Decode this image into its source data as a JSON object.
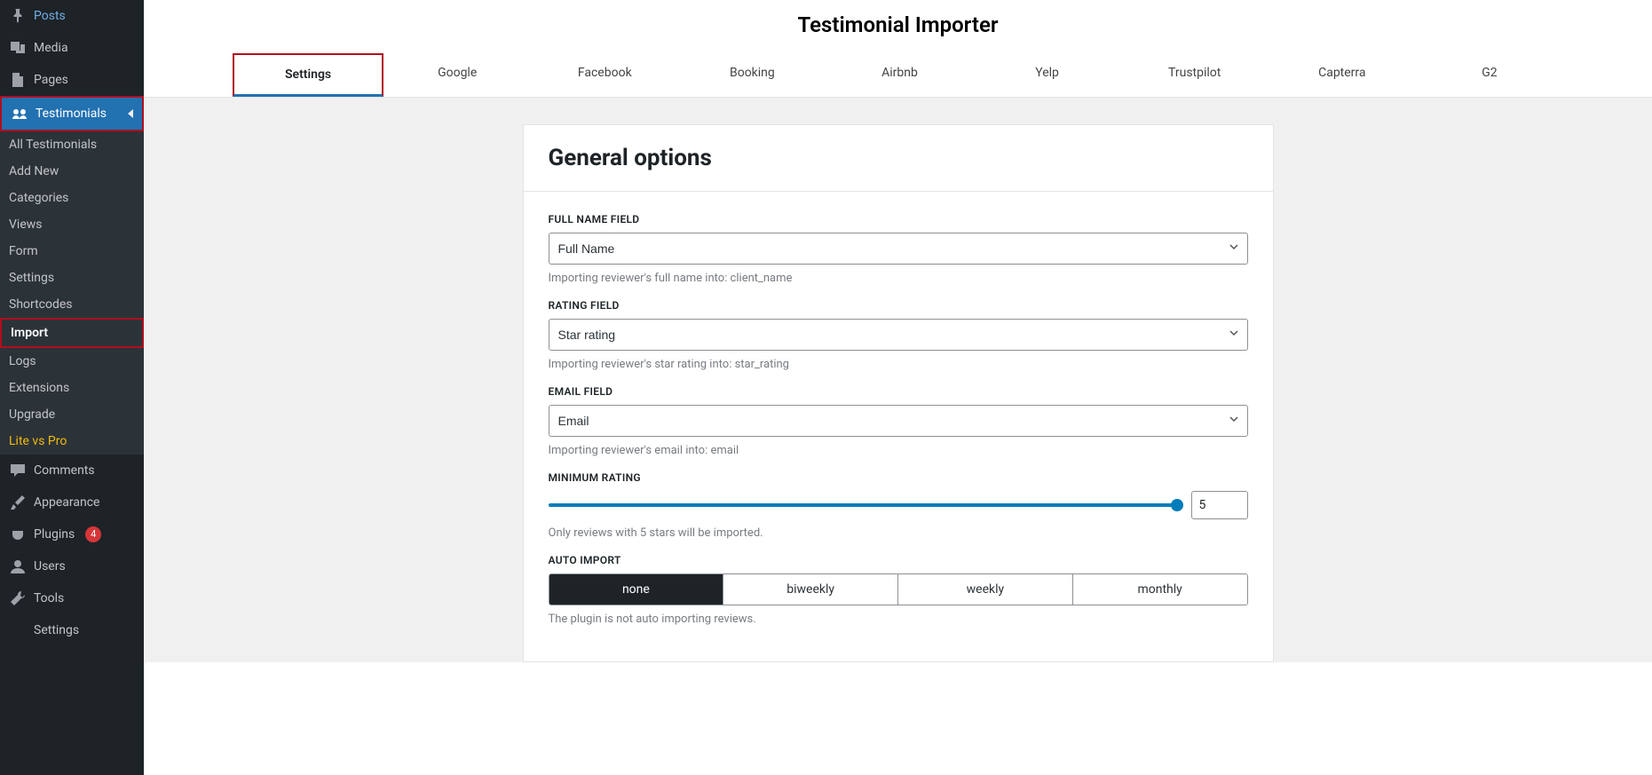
{
  "sidebar": {
    "posts": "Posts",
    "media": "Media",
    "pages": "Pages",
    "testimonials": "Testimonials",
    "sub": {
      "all": "All Testimonials",
      "add": "Add New",
      "categories": "Categories",
      "views": "Views",
      "form": "Form",
      "settings": "Settings",
      "shortcodes": "Shortcodes",
      "import": "Import",
      "logs": "Logs",
      "extensions": "Extensions",
      "upgrade": "Upgrade",
      "litevspro": "Lite vs Pro"
    },
    "comments": "Comments",
    "appearance": "Appearance",
    "plugins": "Plugins",
    "plugins_badge": "4",
    "users": "Users",
    "tools": "Tools",
    "settings": "Settings"
  },
  "page_title": "Testimonial Importer",
  "tabs": [
    "Settings",
    "Google",
    "Facebook",
    "Booking",
    "Airbnb",
    "Yelp",
    "Trustpilot",
    "Capterra",
    "G2"
  ],
  "panel": {
    "header": "General options",
    "fields": {
      "full_name": {
        "label": "FULL NAME FIELD",
        "value": "Full Name",
        "helper": "Importing reviewer's full name into: client_name"
      },
      "rating": {
        "label": "RATING FIELD",
        "value": "Star rating",
        "helper": "Importing reviewer's star rating into: star_rating"
      },
      "email": {
        "label": "EMAIL FIELD",
        "value": "Email",
        "helper": "Importing reviewer's email into: email"
      },
      "min_rating": {
        "label": "MINIMUM RATING",
        "value": "5",
        "helper": "Only reviews with 5 stars will be imported."
      },
      "auto_import": {
        "label": "AUTO IMPORT",
        "options": [
          "none",
          "biweekly",
          "weekly",
          "monthly"
        ],
        "active": "none",
        "helper": "The plugin is not auto importing reviews."
      }
    }
  }
}
